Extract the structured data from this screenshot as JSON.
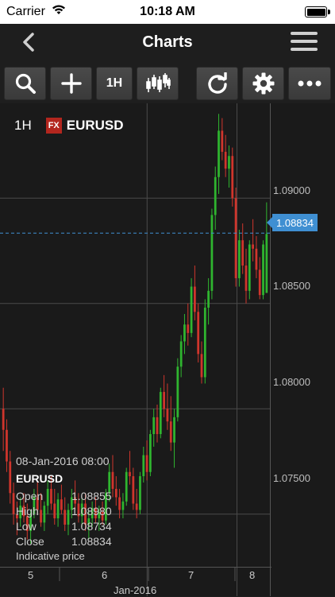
{
  "status": {
    "carrier": "Carrier",
    "time": "10:18 AM"
  },
  "nav": {
    "title": "Charts"
  },
  "toolbar": {
    "timeframe_label": "1H"
  },
  "chart_header": {
    "timeframe": "1H",
    "badge": "FX",
    "symbol": "EURUSD"
  },
  "price_axis": [
    "1.09000",
    "1.08500",
    "1.08000",
    "1.07500"
  ],
  "current_price": "1.08834",
  "info": {
    "timestamp": "08-Jan-2016 08:00",
    "symbol": "EURUSD",
    "rows": [
      {
        "label": "Open",
        "value": "1.08855"
      },
      {
        "label": "High",
        "value": "1.08980"
      },
      {
        "label": "Low",
        "value": "1.08734"
      },
      {
        "label": "Close",
        "value": "1.08834"
      }
    ],
    "note": "Indicative price"
  },
  "x_axis": {
    "days": [
      "5",
      "6",
      "7",
      "8"
    ],
    "month": "Jan-2016"
  },
  "colors": {
    "up": "#2fb52f",
    "down": "#d0352c",
    "accent": "#3f8fd2",
    "grid": "#4a4a4a"
  },
  "chart_data": {
    "type": "candlestick",
    "ylim": [
      1.0725,
      1.0945
    ],
    "candles": [
      [
        1.08,
        1.081,
        1.078,
        1.079
      ],
      [
        1.079,
        1.0795,
        1.077,
        1.0775
      ],
      [
        1.0775,
        1.078,
        1.0755,
        1.076
      ],
      [
        1.076,
        1.0765,
        1.0745,
        1.075
      ],
      [
        1.075,
        1.0756,
        1.074,
        1.0748
      ],
      [
        1.0748,
        1.0758,
        1.0744,
        1.0754
      ],
      [
        1.0754,
        1.076,
        1.0746,
        1.0749
      ],
      [
        1.0749,
        1.0755,
        1.0738,
        1.0742
      ],
      [
        1.0742,
        1.0752,
        1.0736,
        1.075
      ],
      [
        1.075,
        1.0762,
        1.0748,
        1.0758
      ],
      [
        1.0758,
        1.0765,
        1.075,
        1.0752
      ],
      [
        1.0752,
        1.076,
        1.0744,
        1.0746
      ],
      [
        1.0746,
        1.0756,
        1.0742,
        1.0754
      ],
      [
        1.0754,
        1.0766,
        1.075,
        1.0762
      ],
      [
        1.0762,
        1.0768,
        1.0752,
        1.0755
      ],
      [
        1.0755,
        1.0762,
        1.0745,
        1.0748
      ],
      [
        1.0748,
        1.076,
        1.0744,
        1.0757
      ],
      [
        1.0757,
        1.0764,
        1.075,
        1.0752
      ],
      [
        1.0752,
        1.0758,
        1.0742,
        1.0745
      ],
      [
        1.0745,
        1.0755,
        1.074,
        1.0752
      ],
      [
        1.0752,
        1.0762,
        1.0748,
        1.0758
      ],
      [
        1.0758,
        1.0766,
        1.0752,
        1.0755
      ],
      [
        1.0755,
        1.076,
        1.0746,
        1.0749
      ],
      [
        1.0749,
        1.0758,
        1.0744,
        1.0755
      ],
      [
        1.0755,
        1.076,
        1.0742,
        1.0745
      ],
      [
        1.0745,
        1.0752,
        1.0738,
        1.0748
      ],
      [
        1.0748,
        1.0756,
        1.0744,
        1.0753
      ],
      [
        1.0753,
        1.0758,
        1.0746,
        1.0748
      ],
      [
        1.0748,
        1.0754,
        1.0742,
        1.0751
      ],
      [
        1.0751,
        1.0756,
        1.0745,
        1.0747
      ],
      [
        1.0747,
        1.0762,
        1.0745,
        1.076
      ],
      [
        1.076,
        1.0774,
        1.0756,
        1.077
      ],
      [
        1.077,
        1.0778,
        1.0758,
        1.0762
      ],
      [
        1.0762,
        1.0768,
        1.0754,
        1.0758
      ],
      [
        1.0758,
        1.0762,
        1.0748,
        1.0752
      ],
      [
        1.0752,
        1.076,
        1.0748,
        1.0756
      ],
      [
        1.0756,
        1.0772,
        1.0754,
        1.077
      ],
      [
        1.077,
        1.078,
        1.0764,
        1.0768
      ],
      [
        1.0768,
        1.0772,
        1.0752,
        1.0755
      ],
      [
        1.0755,
        1.0762,
        1.0748,
        1.0752
      ],
      [
        1.0752,
        1.077,
        1.075,
        1.0768
      ],
      [
        1.0768,
        1.0782,
        1.0765,
        1.0778
      ],
      [
        1.0778,
        1.0785,
        1.0766,
        1.077
      ],
      [
        1.077,
        1.079,
        1.0768,
        1.0788
      ],
      [
        1.0788,
        1.08,
        1.0782,
        1.0796
      ],
      [
        1.0796,
        1.0802,
        1.0784,
        1.0788
      ],
      [
        1.0788,
        1.081,
        1.0786,
        1.0808
      ],
      [
        1.0808,
        1.0816,
        1.0796,
        1.08
      ],
      [
        1.08,
        1.0812,
        1.079,
        1.0794
      ],
      [
        1.0794,
        1.0806,
        1.078,
        1.0784
      ],
      [
        1.0784,
        1.08,
        1.0772,
        1.0796
      ],
      [
        1.0796,
        1.0824,
        1.0794,
        1.082
      ],
      [
        1.082,
        1.0835,
        1.0815,
        1.0832
      ],
      [
        1.0832,
        1.0845,
        1.0826,
        1.084
      ],
      [
        1.084,
        1.085,
        1.083,
        1.0836
      ],
      [
        1.0836,
        1.0862,
        1.0834,
        1.0858
      ],
      [
        1.0858,
        1.0868,
        1.0842,
        1.0846
      ],
      [
        1.0846,
        1.085,
        1.0822,
        1.0826
      ],
      [
        1.0826,
        1.0832,
        1.0812,
        1.0815
      ],
      [
        1.0815,
        1.0852,
        1.0812,
        1.0848
      ],
      [
        1.0848,
        1.0862,
        1.084,
        1.0856
      ],
      [
        1.0856,
        1.0895,
        1.0852,
        1.0892
      ],
      [
        1.0892,
        1.0915,
        1.0885,
        1.091
      ],
      [
        1.091,
        1.094,
        1.0902,
        1.0932
      ],
      [
        1.0932,
        1.0938,
        1.0918,
        1.0922
      ],
      [
        1.0922,
        1.093,
        1.091,
        1.0914
      ],
      [
        1.0914,
        1.0925,
        1.0905,
        1.092
      ],
      [
        1.092,
        1.0924,
        1.0896,
        1.09
      ],
      [
        1.09,
        1.0905,
        1.0858,
        1.0862
      ],
      [
        1.0862,
        1.0885,
        1.0858,
        1.088
      ],
      [
        1.088,
        1.0888,
        1.0864,
        1.0868
      ],
      [
        1.0868,
        1.0876,
        1.085,
        1.0856
      ],
      [
        1.0856,
        1.088,
        1.0852,
        1.0878
      ],
      [
        1.0878,
        1.089,
        1.087,
        1.0876
      ],
      [
        1.0876,
        1.0882,
        1.0862,
        1.0866
      ],
      [
        1.0866,
        1.0872,
        1.0852,
        1.0854
      ],
      [
        1.0854,
        1.088,
        1.0852,
        1.0878
      ],
      [
        1.0855,
        1.0898,
        1.0873,
        1.0883
      ]
    ]
  }
}
